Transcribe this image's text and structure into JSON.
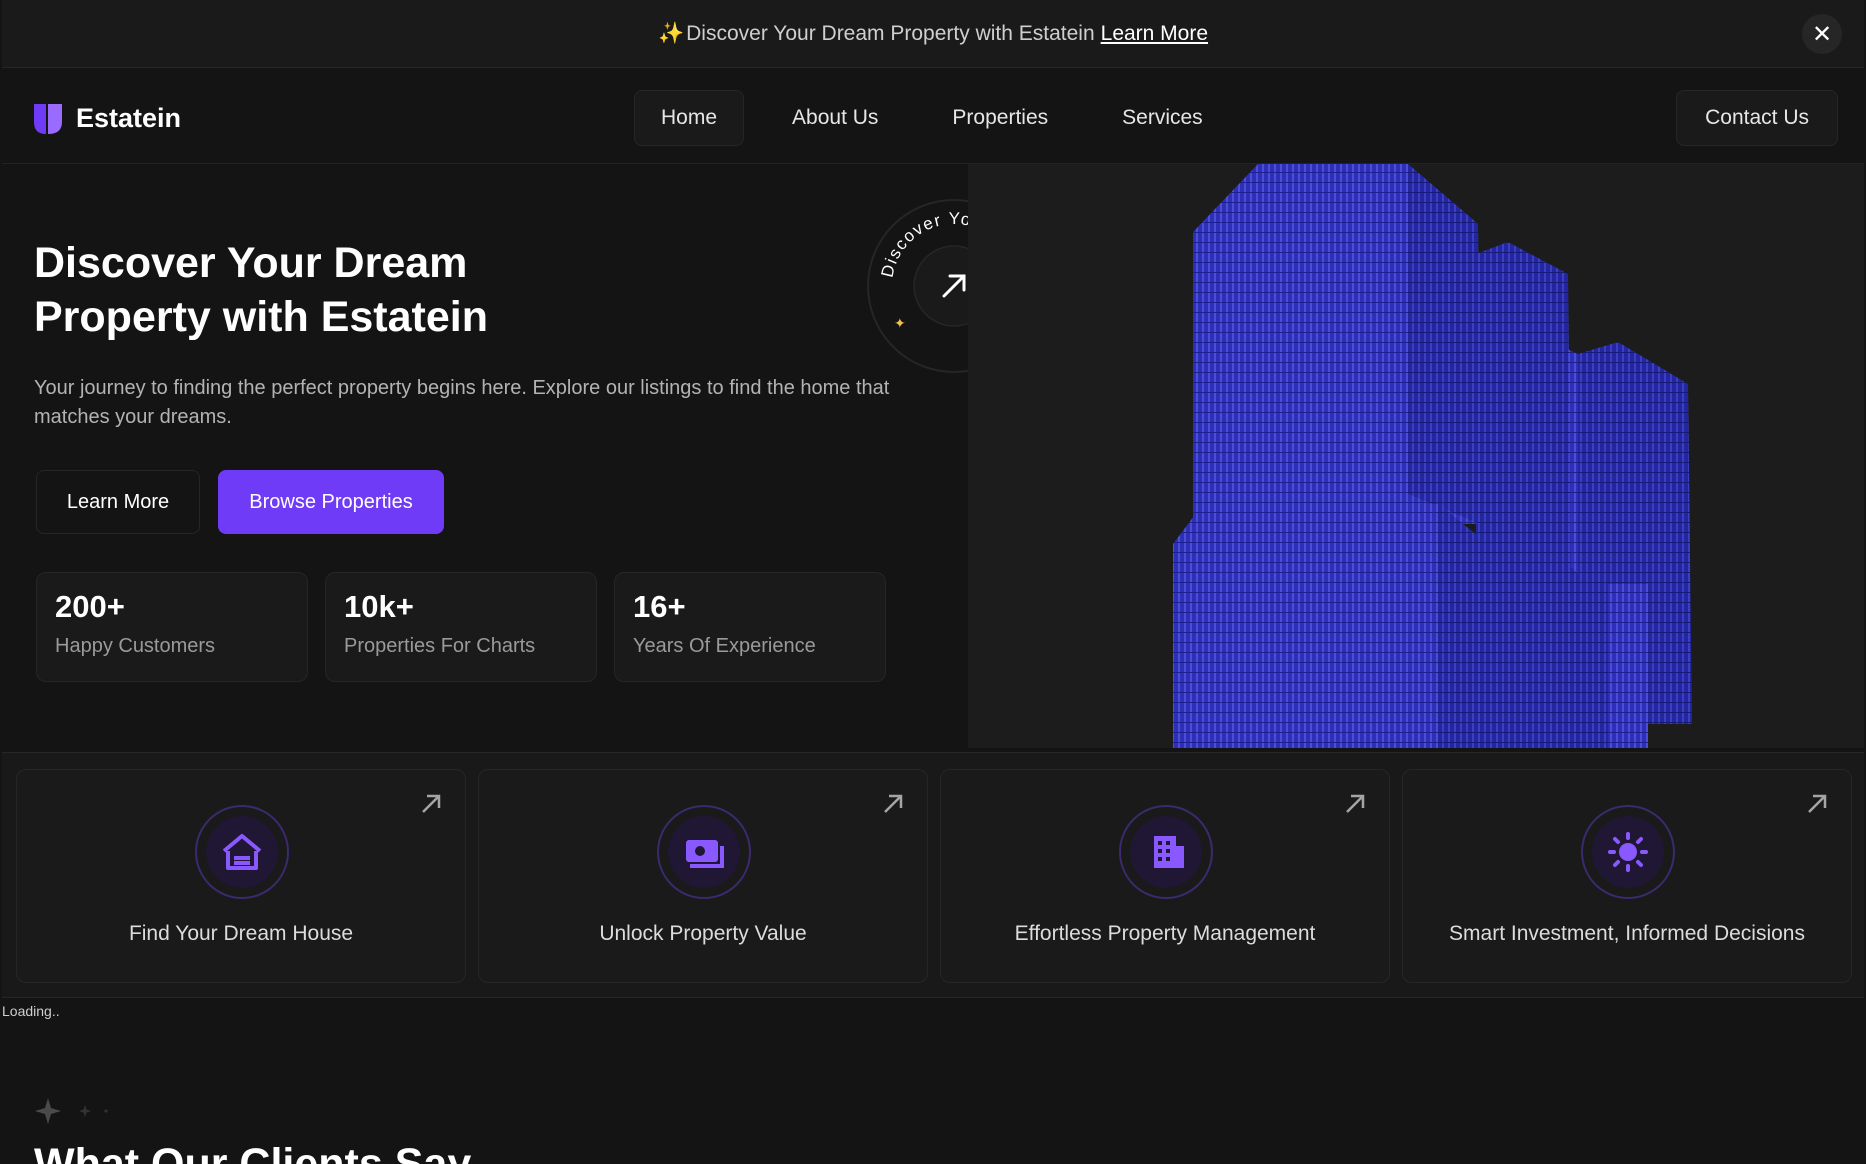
{
  "announcement": {
    "sparkle": "✨",
    "text": "Discover Your Dream Property with Estatein",
    "link": "Learn More",
    "close_icon": "close-icon"
  },
  "brand": {
    "name": "Estatein",
    "accent": "#703bf7"
  },
  "nav": {
    "links": [
      {
        "label": "Home",
        "active": true
      },
      {
        "label": "About Us"
      },
      {
        "label": "Properties"
      },
      {
        "label": "Services"
      }
    ],
    "contact": "Contact Us"
  },
  "hero": {
    "title_line1": "Discover Your Dream",
    "title_line2": "Property with Estatein",
    "subtitle": "Your journey to finding the perfect property begins here. Explore our listings to find the home that matches your dreams.",
    "learn_more": "Learn More",
    "browse": "Browse Properties",
    "badge_text": "Discover Your Dream Property",
    "stats": [
      {
        "value": "200+",
        "label": "Happy Customers"
      },
      {
        "value": "10k+",
        "label": "Properties For Charts"
      },
      {
        "value": "16+",
        "label": "Years Of Experience"
      }
    ]
  },
  "services": [
    {
      "label": "Find Your Dream House",
      "icon": "house-icon"
    },
    {
      "label": "Unlock Property Value",
      "icon": "camera-money-icon"
    },
    {
      "label": "Effortless Property Management",
      "icon": "building-icon"
    },
    {
      "label": "Smart Investment, Informed Decisions",
      "icon": "sun-icon"
    }
  ],
  "loading_text": "Loading..",
  "testimonials": {
    "title": "What Our Clients Say"
  }
}
